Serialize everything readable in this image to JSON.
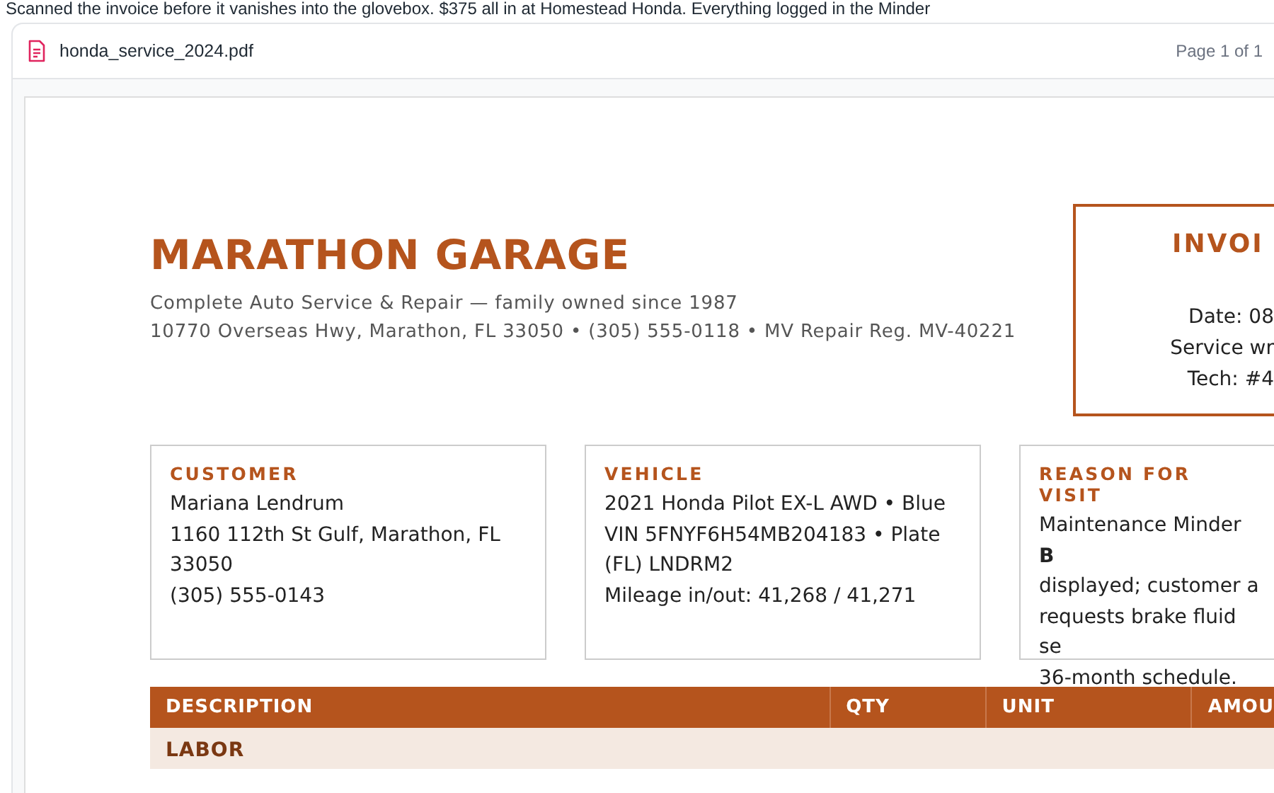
{
  "message": "Scanned the invoice before it vanishes into the glovebox. $375 all in at Homestead Honda. Everything logged in the Minder",
  "viewer": {
    "file_name": "honda_service_2024.pdf",
    "page_indicator": "Page 1 of 1"
  },
  "invoice": {
    "shop_name": "MARATHON GARAGE",
    "tagline": "Complete Auto Service & Repair — family owned since 1987",
    "address": "10770 Overseas Hwy, Marathon, FL 33050 • (305) 555-0118 • MV Repair Reg. MV-40221",
    "invoice_box": {
      "title": "INVOI",
      "lines": [
        "Date: 08",
        "Service wr",
        "Tech: #4"
      ]
    },
    "cards": [
      {
        "heading": "CUSTOMER",
        "lines": [
          "Mariana Lendrum",
          "1160 112th St Gulf, Marathon, FL 33050",
          "(305) 555-0143"
        ]
      },
      {
        "heading": "VEHICLE",
        "lines": [
          "2021 Honda Pilot EX-L AWD • Blue",
          "VIN 5FNYF6H54MB204183 • Plate (FL) LNDRM2",
          "Mileage in/out: 41,268 / 41,271"
        ]
      },
      {
        "heading": "REASON FOR VISIT",
        "lines": [
          "Maintenance Minder **B**",
          "displayed; customer a",
          "requests brake fluid se",
          "36-month schedule."
        ]
      }
    ],
    "table": {
      "columns": [
        "DESCRIPTION",
        "QTY",
        "UNIT",
        "AMOU"
      ],
      "sections": [
        {
          "label": "LABOR"
        }
      ]
    }
  }
}
